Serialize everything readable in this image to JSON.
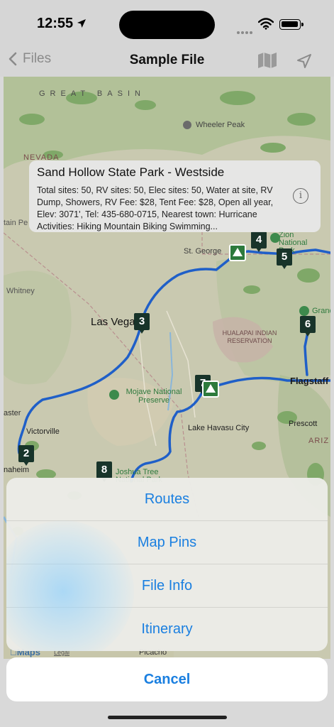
{
  "status": {
    "time": "12:55"
  },
  "nav": {
    "back_label": "Files",
    "title": "Sample File"
  },
  "map": {
    "labels": {
      "great_basin": "GREAT BASIN",
      "wheeler_peak": "Wheeler Peak",
      "nevada": "NEVADA",
      "tain_pe": "tain Pe",
      "whitney": "Whitney",
      "st_george": "St. George",
      "zion": "Zion National Park",
      "las_vegas": "Las Vega",
      "grand": "Grand",
      "hualapai": "HUALAPAI INDIAN RESERVATION",
      "mojave": "Mojave National Preserve",
      "flagstaff": "Flagstaff",
      "aster": "aster",
      "victorville": "Victorville",
      "lake_havasu": "Lake Havasu City",
      "prescott": "Prescott",
      "arizona": "ARIZ",
      "anaheim": "naheim",
      "joshua_tree": "Joshua Tree National Park",
      "picacho": "Picacho",
      "maps_brand": "Maps",
      "legal": "Legal"
    },
    "pins": [
      "2",
      "3",
      "4",
      "5",
      "6",
      "7",
      "8"
    ]
  },
  "callout": {
    "title": "Sand Hollow State Park - Westside",
    "body": "Total sites: 50, RV sites: 50, Elec sites: 50, Water at site, RV Dump, Showers, RV Fee: $28, Tent Fee: $28, Open all year, Elev: 3071', Tel: 435-680-0715, Nearest town: Hurricane Activities: Hiking Mountain Biking Swimming..."
  },
  "action_sheet": {
    "items": [
      "Routes",
      "Map Pins",
      "File Info",
      "Itinerary"
    ],
    "cancel": "Cancel"
  },
  "colors": {
    "accent": "#1a7fe0",
    "route": "#1f5fc8",
    "pin": "#18342a"
  }
}
